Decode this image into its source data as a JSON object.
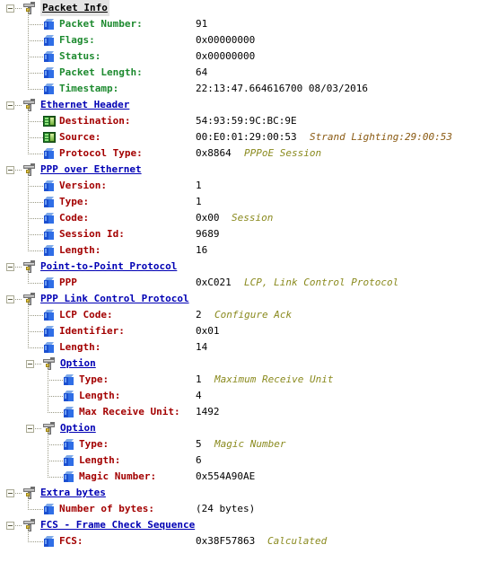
{
  "window": {
    "title": "Packet Decode Tree",
    "background": "#ffffff"
  },
  "colors": {
    "group_blue": "#0000b4",
    "group_selected_text": "#000000",
    "group_selected_bg": "#e4e4e4",
    "field_green": "#1d8a2f",
    "field_red": "#a30000",
    "value_black": "#000000",
    "note_olive": "#8a8a1e",
    "note_brown": "#8a5a12",
    "tree_line": "#9a9a86"
  },
  "tree": [
    {
      "node": "group",
      "id": "packet-info",
      "label": "Packet Info",
      "icon": "protocol-icon",
      "expander": "collapse-icon",
      "selected": true,
      "depth": 0,
      "children": [
        {
          "icon": "cube-icon",
          "label": "Packet Number:",
          "value": "91",
          "note": "",
          "label_color": "green"
        },
        {
          "icon": "cube-icon",
          "label": "Flags:",
          "value": "0x00000000",
          "note": "",
          "label_color": "green"
        },
        {
          "icon": "cube-icon",
          "label": "Status:",
          "value": "0x00000000",
          "note": "",
          "label_color": "green"
        },
        {
          "icon": "cube-icon",
          "label": "Packet Length:",
          "value": "64",
          "note": "",
          "label_color": "green"
        },
        {
          "icon": "cube-icon",
          "label": "Timestamp:",
          "value": "22:13:47.664616700 08/03/2016",
          "note": "",
          "label_color": "green"
        }
      ]
    },
    {
      "node": "group",
      "id": "ethernet-header",
      "label": "Ethernet Header",
      "icon": "protocol-icon",
      "expander": "collapse-icon",
      "selected": false,
      "depth": 0,
      "children": [
        {
          "icon": "nic-icon",
          "label": "Destination:",
          "value": "54:93:59:9C:BC:9E",
          "note": "",
          "note_color": "brown",
          "label_color": "red"
        },
        {
          "icon": "nic-icon",
          "label": "Source:",
          "value": "00:E0:01:29:00:53",
          "note": "Strand Lighting:29:00:53",
          "note_color": "brown",
          "label_color": "red"
        },
        {
          "icon": "cube-icon",
          "label": "Protocol Type:",
          "value": "0x8864",
          "note": "PPPoE Session",
          "note_color": "olive",
          "label_color": "red"
        }
      ]
    },
    {
      "node": "group",
      "id": "ppp-over-ethernet",
      "label": "PPP over Ethernet",
      "icon": "protocol-icon",
      "expander": "collapse-icon",
      "selected": false,
      "depth": 0,
      "children": [
        {
          "icon": "cube-icon",
          "label": "Version:",
          "value": "1",
          "note": "",
          "note_color": "olive",
          "label_color": "red"
        },
        {
          "icon": "cube-icon",
          "label": "Type:",
          "value": "1",
          "note": "",
          "note_color": "olive",
          "label_color": "red"
        },
        {
          "icon": "cube-icon",
          "label": "Code:",
          "value": "0x00",
          "note": "Session",
          "note_color": "olive",
          "label_color": "red"
        },
        {
          "icon": "cube-icon",
          "label": "Session Id:",
          "value": "9689",
          "note": "",
          "note_color": "olive",
          "label_color": "red"
        },
        {
          "icon": "cube-icon",
          "label": "Length:",
          "value": "16",
          "note": "",
          "note_color": "olive",
          "label_color": "red"
        }
      ]
    },
    {
      "node": "group",
      "id": "point-to-point-protocol",
      "label": "Point-to-Point Protocol",
      "icon": "protocol-icon",
      "expander": "collapse-icon",
      "selected": false,
      "depth": 0,
      "children": [
        {
          "icon": "cube-icon",
          "label": "PPP",
          "value": "0xC021",
          "note": "LCP, Link Control Protocol",
          "note_color": "olive",
          "label_color": "red"
        }
      ]
    },
    {
      "node": "group",
      "id": "ppp-link-control-protocol",
      "label": "PPP Link Control Protocol",
      "icon": "protocol-icon",
      "expander": "collapse-icon",
      "selected": false,
      "depth": 0,
      "children": [
        {
          "icon": "cube-icon",
          "label": "LCP Code:",
          "value": "2",
          "note": "Configure Ack",
          "note_color": "olive",
          "label_color": "red"
        },
        {
          "icon": "cube-icon",
          "label": "Identifier:",
          "value": "0x01",
          "note": "",
          "note_color": "olive",
          "label_color": "red"
        },
        {
          "icon": "cube-icon",
          "label": "Length:",
          "value": "14",
          "note": "",
          "note_color": "olive",
          "label_color": "red"
        }
      ]
    },
    {
      "node": "group",
      "id": "option-mru",
      "label": "Option",
      "icon": "protocol-icon",
      "expander": "collapse-icon",
      "selected": false,
      "depth": 1,
      "children": [
        {
          "icon": "cube-icon",
          "label": "Type:",
          "value": "1",
          "note": "Maximum Receive Unit",
          "note_color": "olive",
          "label_color": "red"
        },
        {
          "icon": "cube-icon",
          "label": "Length:",
          "value": "4",
          "note": "",
          "note_color": "olive",
          "label_color": "red"
        },
        {
          "icon": "cube-icon",
          "label": "Max Receive Unit:",
          "value": "1492",
          "note": "",
          "note_color": "olive",
          "label_color": "red"
        }
      ]
    },
    {
      "node": "group",
      "id": "option-magic-number",
      "label": "Option",
      "icon": "protocol-icon",
      "expander": "collapse-icon",
      "selected": false,
      "depth": 1,
      "children": [
        {
          "icon": "cube-icon",
          "label": "Type:",
          "value": "5",
          "note": "Magic Number",
          "note_color": "olive",
          "label_color": "red"
        },
        {
          "icon": "cube-icon",
          "label": "Length:",
          "value": "6",
          "note": "",
          "note_color": "olive",
          "label_color": "red"
        },
        {
          "icon": "cube-icon",
          "label": "Magic Number:",
          "value": "0x554A90AE",
          "note": "",
          "note_color": "olive",
          "label_color": "red"
        }
      ]
    },
    {
      "node": "group",
      "id": "extra-bytes",
      "label": "Extra bytes",
      "icon": "protocol-icon",
      "expander": "collapse-icon",
      "selected": false,
      "depth": 0,
      "children": [
        {
          "icon": "cube-icon",
          "label": "Number of bytes:",
          "value": "(24 bytes)",
          "note": "",
          "note_color": "olive",
          "label_color": "red"
        }
      ]
    },
    {
      "node": "group",
      "id": "fcs-frame-check-sequence",
      "label": "FCS - Frame Check Sequence",
      "icon": "protocol-icon",
      "expander": "collapse-icon",
      "selected": false,
      "depth": 0,
      "children": [
        {
          "icon": "cube-icon",
          "label": "FCS:",
          "value": "0x38F57863",
          "note": "Calculated",
          "note_color": "olive",
          "label_color": "red"
        }
      ]
    }
  ]
}
